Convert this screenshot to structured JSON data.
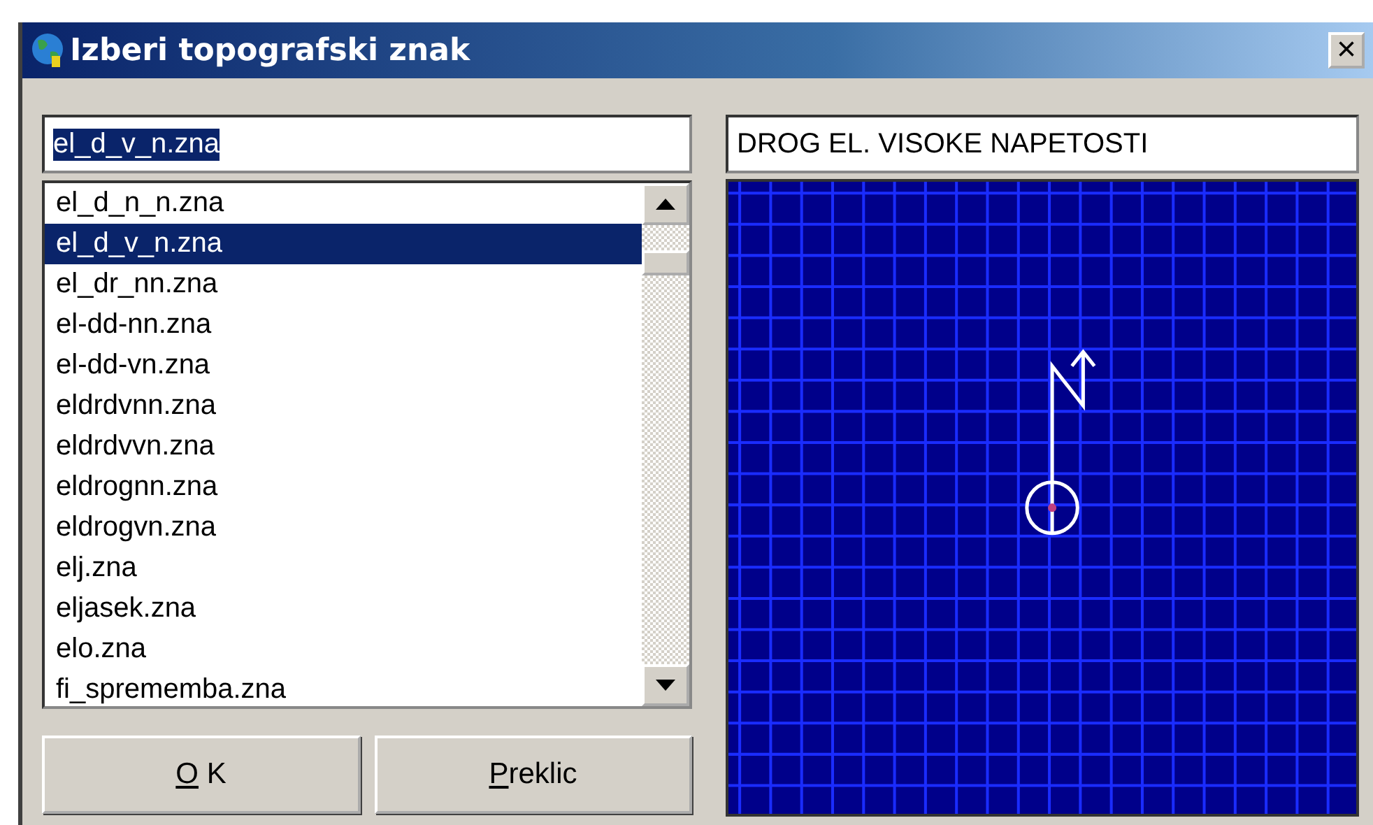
{
  "window": {
    "title": "Izberi topografski znak",
    "close": "×"
  },
  "file_field": {
    "value": "el_d_v_n.zna",
    "text_selected": true
  },
  "file_list": {
    "items": [
      {
        "label": "el_d_n_n.zna",
        "selected": false
      },
      {
        "label": "el_d_v_n.zna",
        "selected": true
      },
      {
        "label": "el_dr_nn.zna",
        "selected": false
      },
      {
        "label": "el-dd-nn.zna",
        "selected": false
      },
      {
        "label": "el-dd-vn.zna",
        "selected": false
      },
      {
        "label": "eldrdvnn.zna",
        "selected": false
      },
      {
        "label": "eldrdvvn.zna",
        "selected": false
      },
      {
        "label": "eldrognn.zna",
        "selected": false
      },
      {
        "label": "eldrogvn.zna",
        "selected": false
      },
      {
        "label": "elj.zna",
        "selected": false
      },
      {
        "label": "eljasek.zna",
        "selected": false
      },
      {
        "label": "elo.zna",
        "selected": false
      },
      {
        "label": "fi_sprememba.zna",
        "selected": false
      }
    ]
  },
  "buttons": [
    {
      "mnemonic": "O",
      "rest": " K"
    },
    {
      "mnemonic": "P",
      "rest": "reklic"
    }
  ],
  "description_field": {
    "value": "DROG EL. VISOKE NAPETOSTI"
  }
}
